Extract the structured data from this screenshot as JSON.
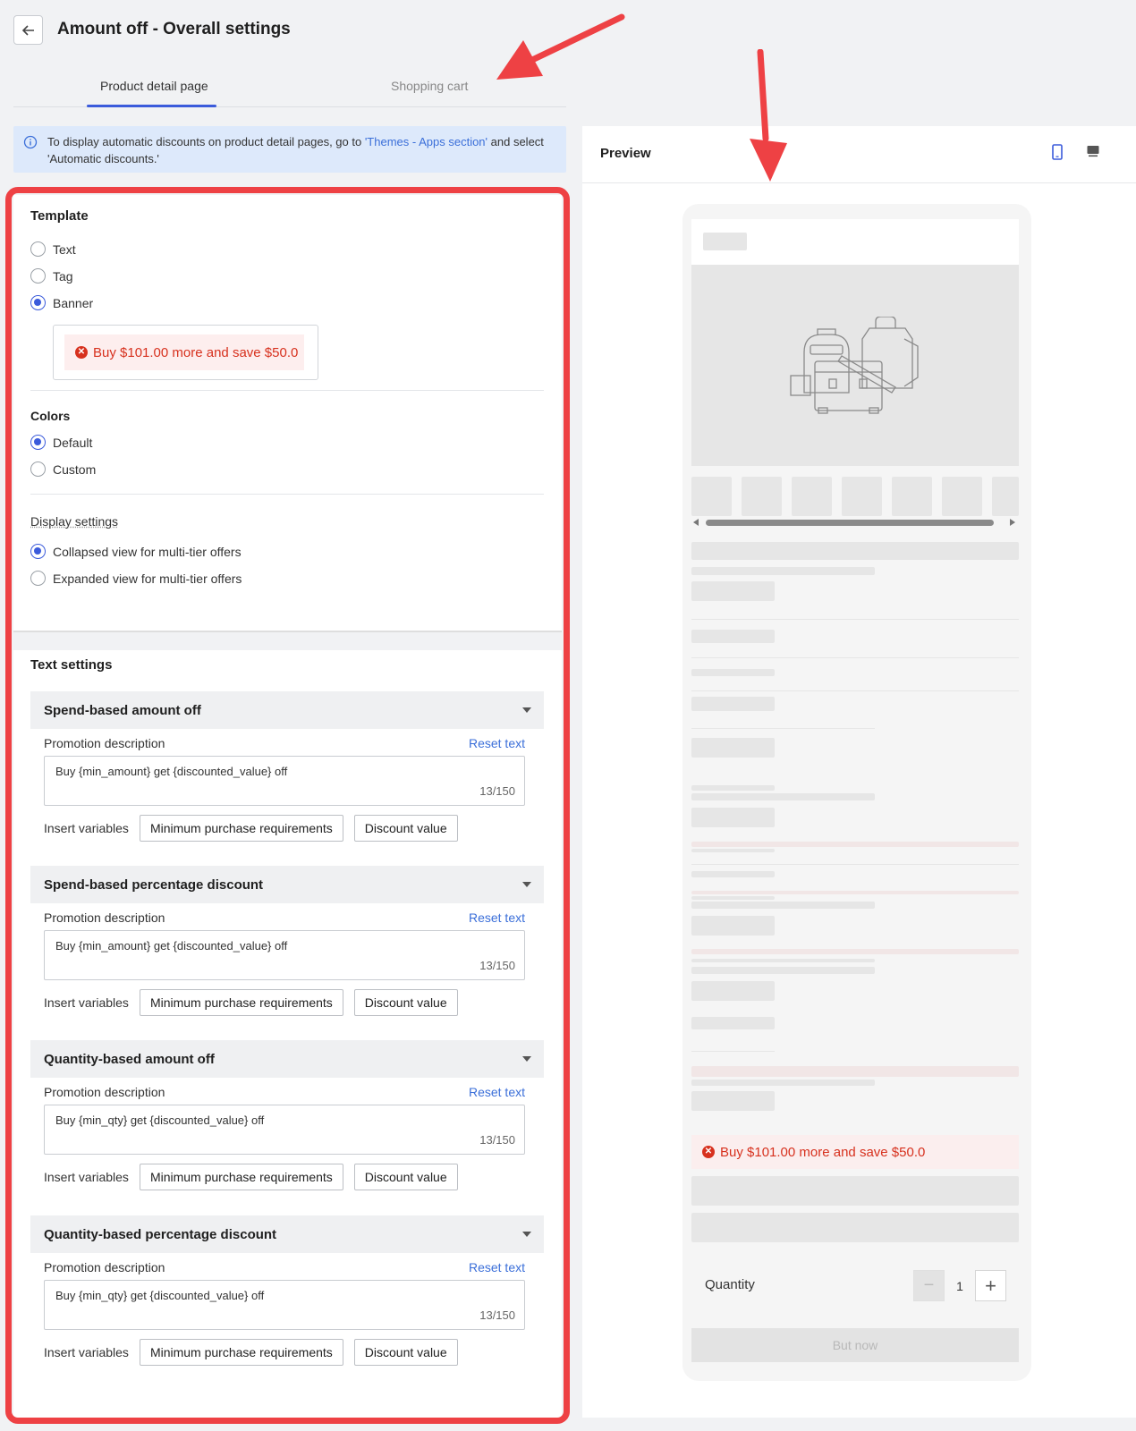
{
  "header": {
    "title": "Amount off - Overall settings"
  },
  "tabs": [
    {
      "label": "Product detail page",
      "active": true
    },
    {
      "label": "Shopping cart",
      "active": false
    }
  ],
  "info": {
    "text_before": "To display automatic discounts on product detail pages, go to ",
    "link": "'Themes - Apps section'",
    "text_after": " and select 'Automatic discounts.'"
  },
  "template": {
    "title": "Template",
    "options": [
      "Text",
      "Tag",
      "Banner"
    ],
    "selected": "Banner",
    "banner_preview": "Buy $101.00 more and save $50.0"
  },
  "colors": {
    "title": "Colors",
    "options": [
      "Default",
      "Custom"
    ],
    "selected": "Default"
  },
  "display": {
    "title": "Display settings",
    "options": [
      "Collapsed view for multi-tier offers",
      "Expanded view for multi-tier offers"
    ],
    "selected": "Collapsed view for multi-tier offers"
  },
  "text_settings": {
    "title": "Text settings",
    "label_desc": "Promotion description",
    "reset": "Reset text",
    "insert_label": "Insert variables",
    "btn_min": "Minimum purchase requirements",
    "btn_disc": "Discount value",
    "sections": [
      {
        "title": "Spend-based amount off",
        "value": "Buy {min_amount} get {discounted_value} off",
        "count": "13/150"
      },
      {
        "title": "Spend-based percentage discount",
        "value": "Buy {min_amount} get {discounted_value} off",
        "count": "13/150"
      },
      {
        "title": "Quantity-based amount off",
        "value": "Buy {min_qty} get {discounted_value} off",
        "count": "13/150"
      },
      {
        "title": "Quantity-based percentage discount",
        "value": "Buy {min_qty} get {discounted_value} off",
        "count": "13/150"
      }
    ]
  },
  "preview": {
    "title": "Preview",
    "banner": "Buy $101.00 more and save $50.0",
    "quantity_label": "Quantity",
    "quantity_value": "1",
    "buy_label": "But now"
  },
  "colors_accent": {
    "primary": "#3b5bdb",
    "danger": "#d7311e",
    "annotation": "#ee4144"
  }
}
